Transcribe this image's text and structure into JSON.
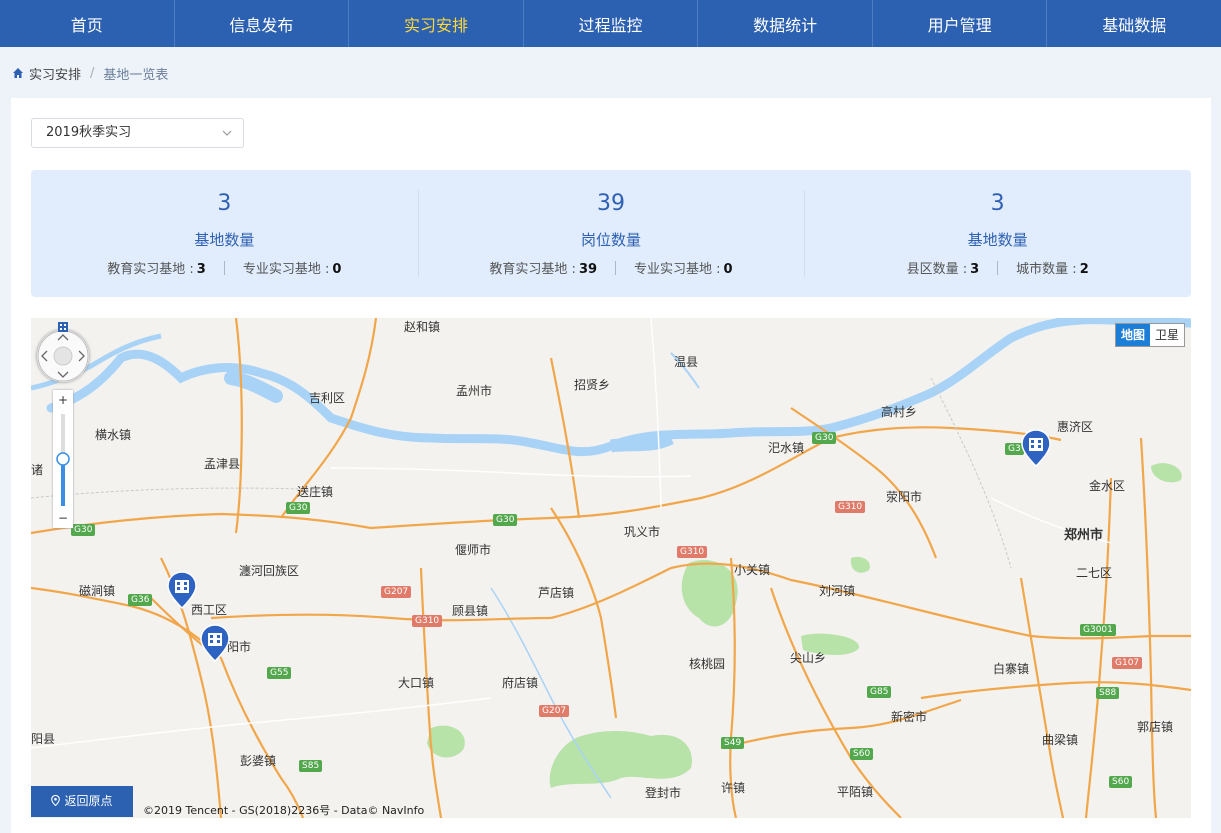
{
  "nav": {
    "items": [
      "首页",
      "信息发布",
      "实习安排",
      "过程监控",
      "数据统计",
      "用户管理",
      "基础数据"
    ],
    "active_index": 2
  },
  "breadcrumb": {
    "root": "实习安排",
    "separator": "/",
    "current": "基地一览表"
  },
  "filter": {
    "selected": "2019秋季实习"
  },
  "stats": [
    {
      "value": "3",
      "label": "基地数量",
      "items": [
        {
          "label": "教育实习基地 :",
          "value": "3"
        },
        {
          "label": "专业实习基地 :",
          "value": "0"
        }
      ]
    },
    {
      "value": "39",
      "label": "岗位数量",
      "items": [
        {
          "label": "教育实习基地 :",
          "value": "39"
        },
        {
          "label": "专业实习基地 :",
          "value": "0"
        }
      ]
    },
    {
      "value": "3",
      "label": "基地数量",
      "items": [
        {
          "label": "县区数量 :",
          "value": "3"
        },
        {
          "label": "城市数量 :",
          "value": "2"
        }
      ]
    }
  ],
  "map": {
    "type_toggle": {
      "map": "地图",
      "satellite": "卫星"
    },
    "zoom_in": "+",
    "zoom_out": "−",
    "back_button": "返回原点",
    "copyright": "©2019 Tencent - GS(2018)2236号 - Data© NavInfo",
    "places": [
      "赵和镇",
      "温县",
      "孟州市",
      "招贤乡",
      "吉利区",
      "高村乡",
      "惠济区",
      "横水镇",
      "孟津县",
      "汜水镇",
      "金水区",
      "送庄镇",
      "荥阳市",
      "偃师市",
      "巩义市",
      "郑州市",
      "二七区",
      "瀍河回族区",
      "小关镇",
      "磁涧镇",
      "西工区",
      "顾县镇",
      "刘河镇",
      "芦店镇",
      "阳市",
      "核桃园",
      "尖山乡",
      "白寨镇",
      "大口镇",
      "府店镇",
      "新密市",
      "曲梁镇",
      "郭店镇",
      "彭婆镇",
      "登封市",
      "平陌镇",
      "阳县",
      "许镇",
      "诸"
    ],
    "road_shields": [
      "G30",
      "G30",
      "G30",
      "G30",
      "G36",
      "G55",
      "S85",
      "G207",
      "G310",
      "G310",
      "G310",
      "G207",
      "G3001",
      "G107",
      "S88",
      "G85",
      "S49",
      "S60",
      "S60",
      "G3"
    ],
    "colors": {
      "river": "#a9d3f6",
      "highway": "#f2a64a",
      "park": "#b7e2a8",
      "marker": "#2e63c2"
    }
  }
}
